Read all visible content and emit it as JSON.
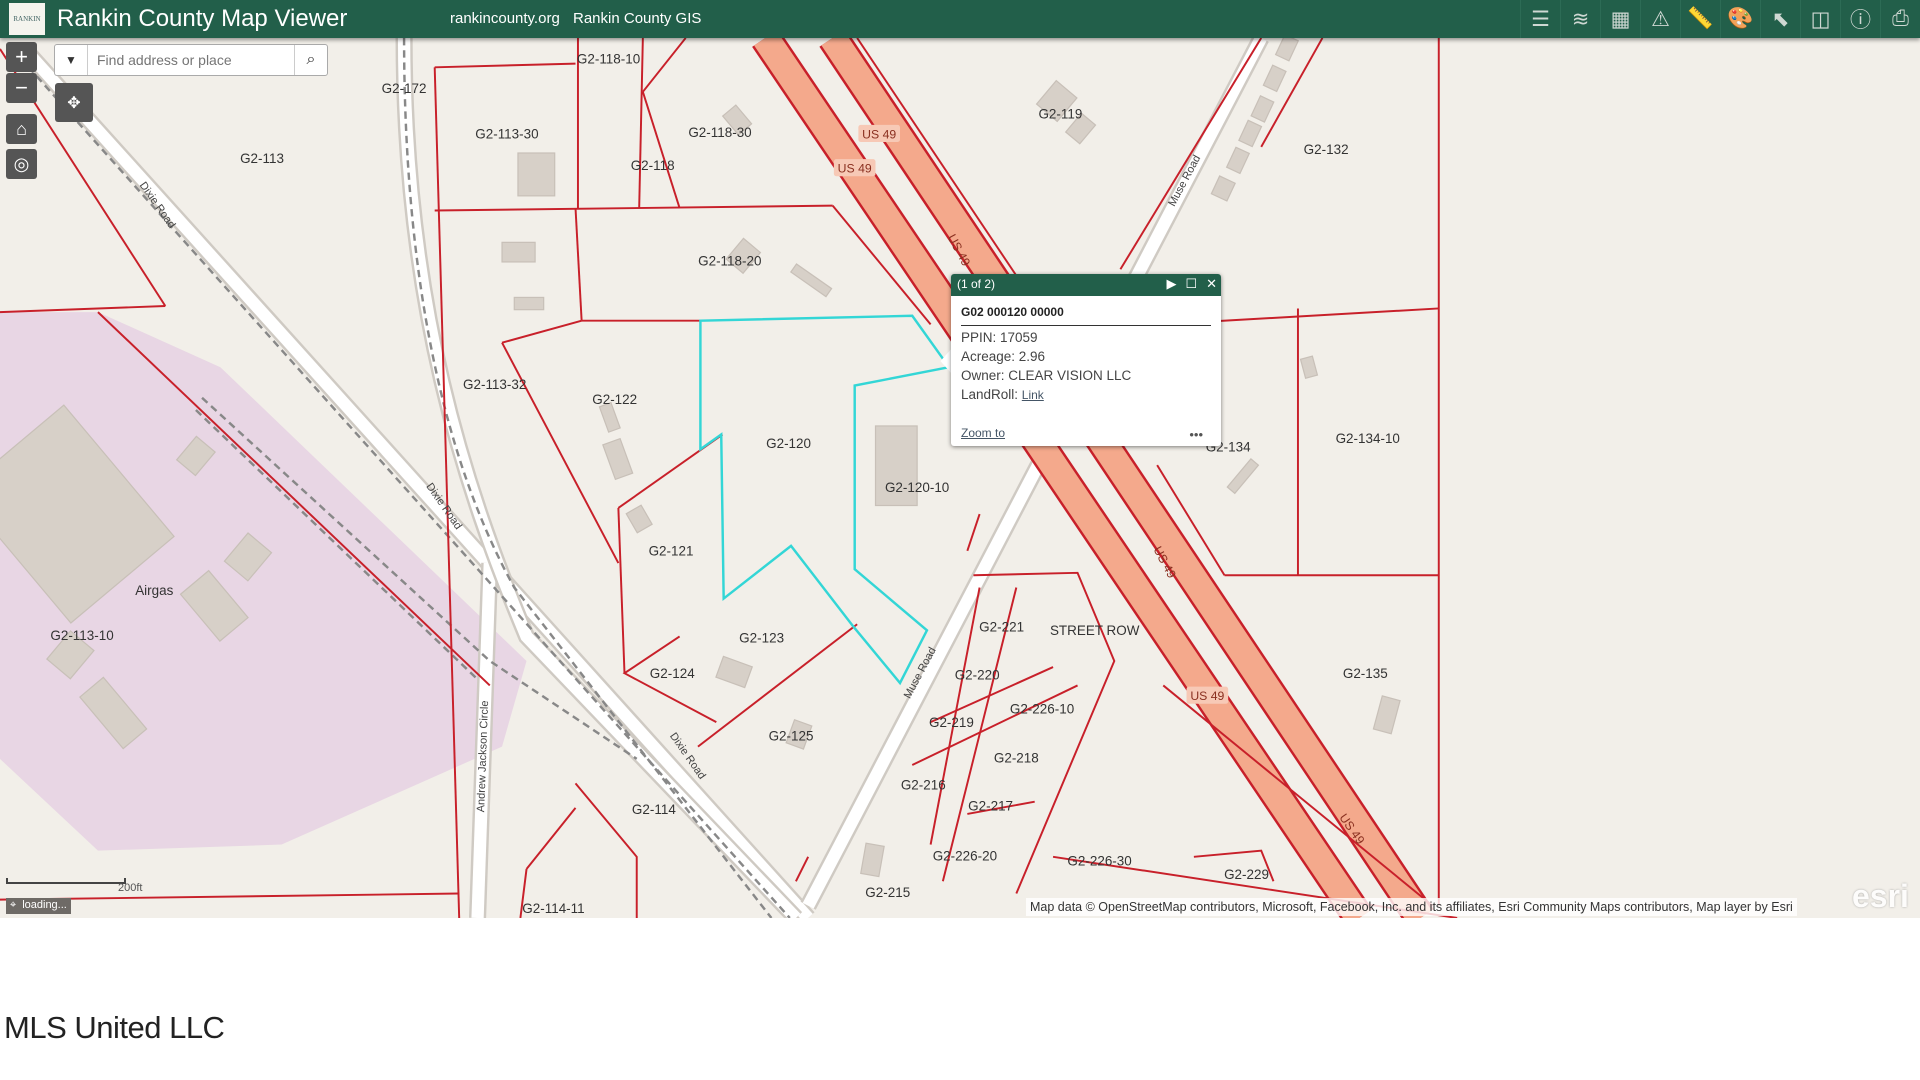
{
  "header": {
    "logo_text": "RANKIN",
    "title": "Rankin County Map Viewer",
    "links": [
      "rankincounty.org",
      "Rankin County GIS"
    ],
    "tools": [
      {
        "name": "legend-icon",
        "glyph": "☰"
      },
      {
        "name": "layers-icon",
        "glyph": "≋"
      },
      {
        "name": "basemap-gallery-icon",
        "glyph": "▦"
      },
      {
        "name": "warning-icon",
        "glyph": "⚠"
      },
      {
        "name": "measure-icon",
        "glyph": "📏"
      },
      {
        "name": "draw-palette-icon",
        "glyph": "🎨"
      },
      {
        "name": "select-icon",
        "glyph": "⬉"
      },
      {
        "name": "swipe-icon",
        "glyph": "◫"
      },
      {
        "name": "info-icon",
        "glyph": "ⓘ"
      },
      {
        "name": "print-icon",
        "glyph": "⎙"
      }
    ]
  },
  "controls": {
    "zoom_in": "+",
    "zoom_out": "−",
    "search_placeholder": "Find address or place"
  },
  "popup": {
    "counter": "(1 of 2)",
    "parcel_id": "G02 000120 00000",
    "ppin": "PPIN: 17059",
    "acreage": "Acreage: 2.96",
    "owner": "Owner: CLEAR VISION LLC",
    "landroll_label": "LandRoll: ",
    "landroll_link": "Link",
    "zoom_to": "Zoom to",
    "more": "•••"
  },
  "map": {
    "parcel_labels": [
      "G2-118-10",
      "G2-172",
      "G2-113",
      "G2-113-30",
      "G2-118-30",
      "G2-118",
      "G2-119",
      "G2-132",
      "G2-118-20",
      "G2-113-32",
      "G2-122",
      "G2-120",
      "G2-120-10",
      "G2-134",
      "G2-134-10",
      "G2-121",
      "Airgas",
      "G2-113-10",
      "G2-123",
      "G2-124",
      "G2-221",
      "STREET ROW",
      "G2-220",
      "G2-226-10",
      "G2-219",
      "G2-218",
      "G2-125",
      "G2-216",
      "G2-217",
      "G2-114",
      "G2-226-20",
      "G2-226-30",
      "G2-229",
      "G2-215",
      "G2-114-11",
      "G2-135"
    ],
    "road_labels": [
      "Dixie Road",
      "Dixie Road",
      "Dixie Road",
      "Muse Road",
      "Muse Road",
      "Andrew Jackson Circle",
      "US 49",
      "US 49",
      "US 49",
      "US 49",
      "US 49",
      "US 49"
    ],
    "colors": {
      "parcel_line": "#c8202a",
      "selected_parcel": "#33d6d6",
      "highway": "#f4a98c",
      "industrial": "#e8d6e4",
      "background": "#f2efe9"
    }
  },
  "scale_label": "200ft",
  "status": "loading...",
  "attribution": "Map data © OpenStreetMap contributors, Microsoft, Facebook, Inc. and its affiliates, Esri Community Maps contributors, Map layer by Esri",
  "esri_logo": "esri",
  "footer": "MLS United LLC"
}
